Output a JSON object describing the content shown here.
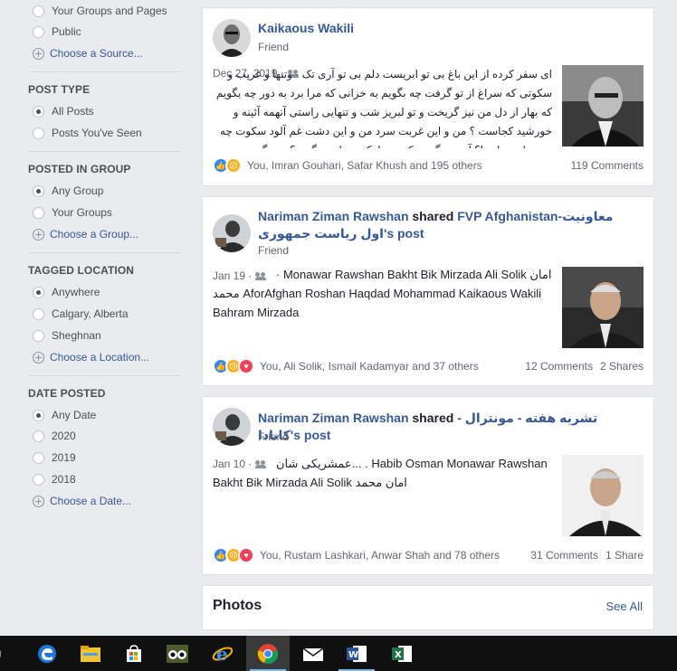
{
  "sidebar": {
    "source_options": [
      {
        "label": "Your Groups and Pages"
      },
      {
        "label": "Public"
      }
    ],
    "choose_source": "Choose a Source...",
    "post_type": {
      "title": "POST TYPE",
      "options": [
        {
          "label": "All Posts",
          "selected": true
        },
        {
          "label": "Posts You've Seen",
          "selected": false
        }
      ]
    },
    "posted_in_group": {
      "title": "POSTED IN GROUP",
      "options": [
        {
          "label": "Any Group",
          "selected": true
        },
        {
          "label": "Your Groups",
          "selected": false
        }
      ],
      "choose": "Choose a Group..."
    },
    "tagged_location": {
      "title": "TAGGED LOCATION",
      "options": [
        {
          "label": "Anywhere",
          "selected": true
        },
        {
          "label": "Calgary, Alberta",
          "selected": false
        },
        {
          "label": "Sheghnan",
          "selected": false
        }
      ],
      "choose": "Choose a Location..."
    },
    "date_posted": {
      "title": "DATE POSTED",
      "options": [
        {
          "label": "Any Date",
          "selected": true
        },
        {
          "label": "2020",
          "selected": false
        },
        {
          "label": "2019",
          "selected": false
        },
        {
          "label": "2018",
          "selected": false
        }
      ],
      "choose": "Choose a Date..."
    }
  },
  "posts": [
    {
      "author": "Kaikaous Wakili",
      "relation": "Friend",
      "date": "Dec 27, 2019 ·",
      "text": "ای سفر کرده از این باغ بی تو ابریست دلم بی تو آری تک · وتنها و غریب و سکوتی که سراغ از تو گرفت چه بگویم به خزانی که مرا برد به دور چه بگویم که بهار از دل من نیز گریخت و تو لبریز شب و تنهایی راستی آنهمه آئینه و خورشید کجاست ؟ من و این غربت سرد من و این دشت غم آلود سکوت چه وسیع است اینجا؟ آه چه بگویم تک و تنها تک وتنها چه بگویم؟ چه بگویم به...",
      "reactions_text": "You, Imran Gouhari, Safar Khush and 195 others",
      "comments": "119 Comments"
    },
    {
      "author": "Nariman Ziman Rawshan",
      "shared_word": "shared",
      "shared_page": "FVP Afghanistan-معاونیت اول ریاست جمهوری",
      "post_word": "'s post",
      "relation": "Friend",
      "date": "Jan 19 ·",
      "text": "· Monawar Rawshan Bakht Bik Mirzada Ali Solik امان محمد AforAfghan Roshan Haqdad Mohammad Kaikaous Wakili Bahram Mirzada",
      "reactions_text": "You, Ali Solik, Ismail Kadamyar and 37 others",
      "comments": "12 Comments",
      "shares": "2 Shares"
    },
    {
      "author": "Nariman Ziman Rawshan",
      "shared_word": "shared",
      "shared_page": "تشریه هفته - مونترال - کانادا",
      "post_word": "'s post",
      "relation": "Friend",
      "date": "Jan 10 ·",
      "text": "عمشریکی شان... . Habib Osman Monawar Rawshan Bakht Bik Mirzada Ali Solik امان محمد",
      "reactions_text": "You, Rustam Lashkari, Anwar Shah and 78 others",
      "comments": "31 Comments",
      "shares": "1 Share"
    }
  ],
  "photos": {
    "title": "Photos",
    "see_all": "See All"
  },
  "taskbar": {
    "items": [
      "task-view-icon",
      "edge-icon",
      "file-explorer-icon",
      "store-icon",
      "tripadvisor-icon",
      "internet-explorer-icon",
      "chrome-icon",
      "mail-icon",
      "word-icon",
      "excel-icon"
    ],
    "active": "chrome-icon"
  }
}
